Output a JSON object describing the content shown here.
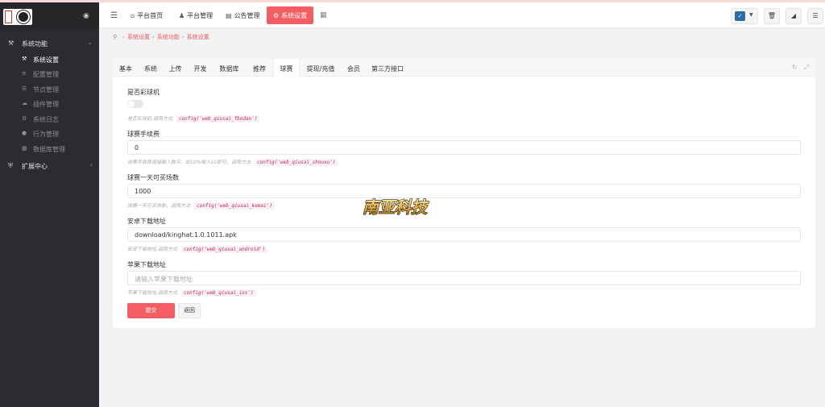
{
  "sidebar": {
    "groups": [
      {
        "label": "系统功能",
        "icon": "wrench-icon"
      },
      {
        "label": "扩展中心",
        "icon": "shield-icon"
      }
    ],
    "items": [
      {
        "label": "系统设置",
        "icon": "wrench-icon",
        "active": true
      },
      {
        "label": "配置管理",
        "icon": "sliders-icon"
      },
      {
        "label": "节点管理",
        "icon": "list-icon"
      },
      {
        "label": "插件管理",
        "icon": "cloud-icon"
      },
      {
        "label": "系统日志",
        "icon": "gear-icon"
      },
      {
        "label": "行为管理",
        "icon": "user-icon"
      },
      {
        "label": "数据库管理",
        "icon": "database-icon"
      }
    ]
  },
  "header": {
    "tabs": [
      {
        "label": "平台首页",
        "icon": "home-icon"
      },
      {
        "label": "平台管理",
        "icon": "user-icon"
      },
      {
        "label": "公告管理",
        "icon": "card-icon"
      },
      {
        "label": "系统设置",
        "icon": "gear-icon",
        "active": true
      }
    ]
  },
  "breadcrumb": [
    "系统设置",
    "系统功能",
    "系统设置"
  ],
  "tabs": [
    "基本",
    "系统",
    "上传",
    "开发",
    "数据库",
    "推荐",
    "球赛",
    "提现/充值",
    "会员",
    "第三方接口"
  ],
  "active_tab": "球赛",
  "form": {
    "fields": [
      {
        "label": "是否彩球机",
        "type": "toggle",
        "help": "是否彩球机,调用方式:",
        "code": "config('web_qiusai_fbodan')"
      },
      {
        "label": "球赛手续费",
        "type": "input",
        "value": "0",
        "help": "球赛手续费直接输入数字，如10%输入10即可。调用方法:",
        "code": "config('web_qiusai_shouxu')"
      },
      {
        "label": "球赛一天可买场数",
        "type": "input",
        "value": "1000",
        "help": "球赛一天可买场数，调用方法:",
        "code": "config('web_qiusai_kemai')"
      },
      {
        "label": "安卓下载地址",
        "type": "input",
        "value": "download/kinghat.1.0.1011.apk",
        "help": "安卓下载地址,调用方式:",
        "code": "config('web_qiusai_android')"
      },
      {
        "label": "苹果下载地址",
        "type": "input",
        "value": "",
        "placeholder": "请输入苹果下载地址",
        "help": "苹果下载地址,调用方式:",
        "code": "config('web_qiusai_ios')"
      }
    ],
    "submit_label": "提交",
    "back_label": "返回"
  },
  "watermark": "南亚科技",
  "colors": {
    "accent": "#f45e63",
    "sidebar": "#2b2c2f"
  }
}
